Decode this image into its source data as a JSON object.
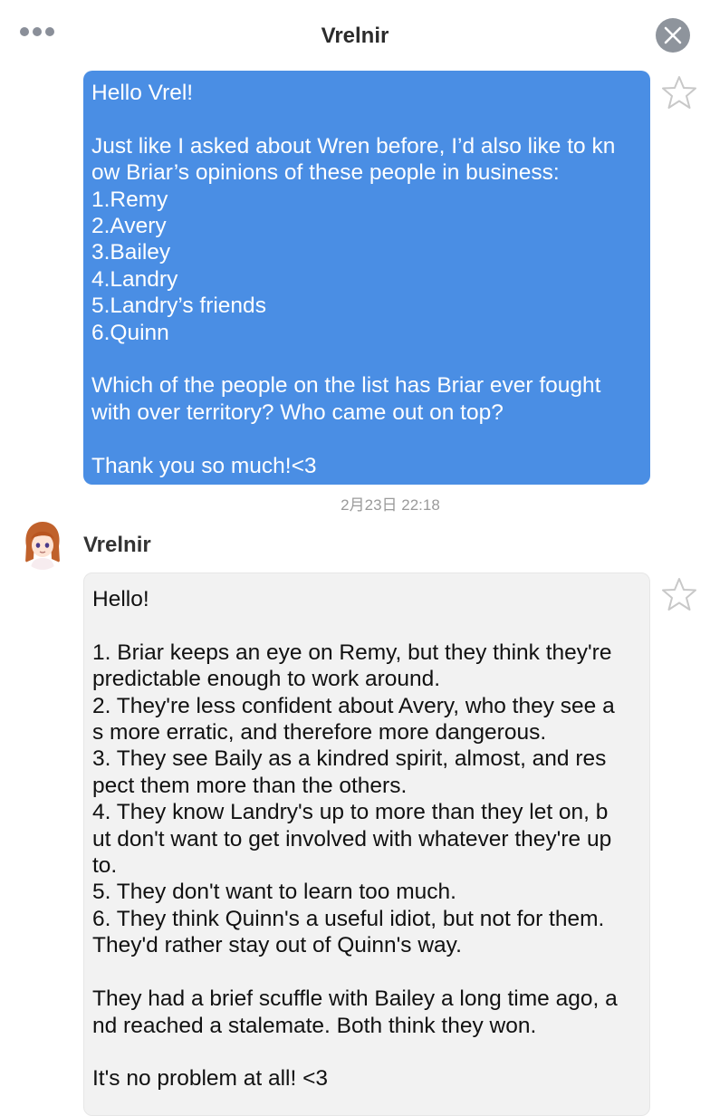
{
  "header": {
    "title": "Vrelnir",
    "more_icon": "ellipsis-icon",
    "close_icon": "close-icon"
  },
  "outgoing_message": {
    "text": "Hello Vrel!\n\nJust like I asked about Wren before, I’d also like to kn\now Briar’s opinions of these people in business:\n1.Remy\n2.Avery\n3.Bailey\n4.Landry\n5.Landry’s friends\n6.Quinn\n\nWhich of the people on the list has Briar ever fought\nwith over territory? Who came out on top?\n\nThank you so much!<3",
    "timestamp": "2月23日 22:18",
    "bubble_color": "#4a8ee4"
  },
  "incoming_message": {
    "sender": "Vrelnir",
    "text": "Hello!\n\n1. Briar keeps an eye on Remy, but they think they're\npredictable enough to work around.\n2. They're less confident about Avery, who they see a\ns more erratic, and therefore more dangerous.\n3. They see Baily as a kindred spirit, almost, and res\npect them more than the others.\n4. They know Landry's up to more than they let on, b\nut don't want to get involved with whatever they're up\nto.\n5. They don't want to learn too much.\n6. They think Quinn's a useful idiot, but not for them.\nThey'd rather stay out of Quinn's way.\n\nThey had a brief scuffle with Bailey a long time ago, a\nnd reached a stalemate. Both think they won.\n\nIt's no problem at all! <3",
    "bubble_color": "#f2f2f2"
  },
  "icons": {
    "star": "star-outline-icon",
    "avatar": "avatar"
  }
}
